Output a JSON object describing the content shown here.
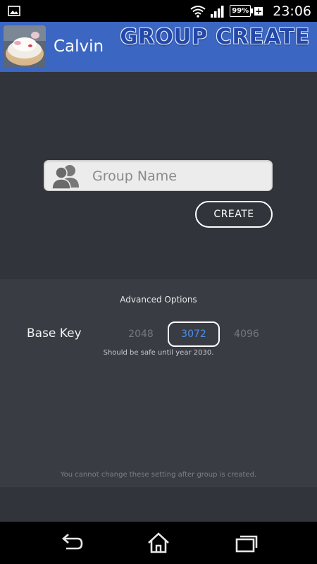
{
  "status_bar": {
    "time": "23:06",
    "battery_percent": "99%",
    "battery_charging_symbol": "+",
    "icons": [
      "gallery-icon",
      "wifi-icon",
      "signal-icon",
      "battery-icon"
    ]
  },
  "header": {
    "user_name": "Calvin",
    "screen_title": "GROUP CREATE",
    "colors": {
      "background": "#3b66c2",
      "title": "#2448a8"
    }
  },
  "form": {
    "group_name_placeholder": "Group Name",
    "group_name_value": "",
    "create_label": "CREATE"
  },
  "advanced": {
    "title": "Advanced Options",
    "base_key_label": "Base Key",
    "key_options": [
      "2048",
      "3072",
      "4096"
    ],
    "selected_key": "3072",
    "hint": "Should be safe until year 2030.",
    "note": "You cannot change these setting after group is created.",
    "colors": {
      "selected": "#4d8ee8",
      "unselected": "#75777d"
    }
  },
  "nav_bar": {
    "icons": [
      "back-icon",
      "home-icon",
      "recent-apps-icon"
    ]
  }
}
